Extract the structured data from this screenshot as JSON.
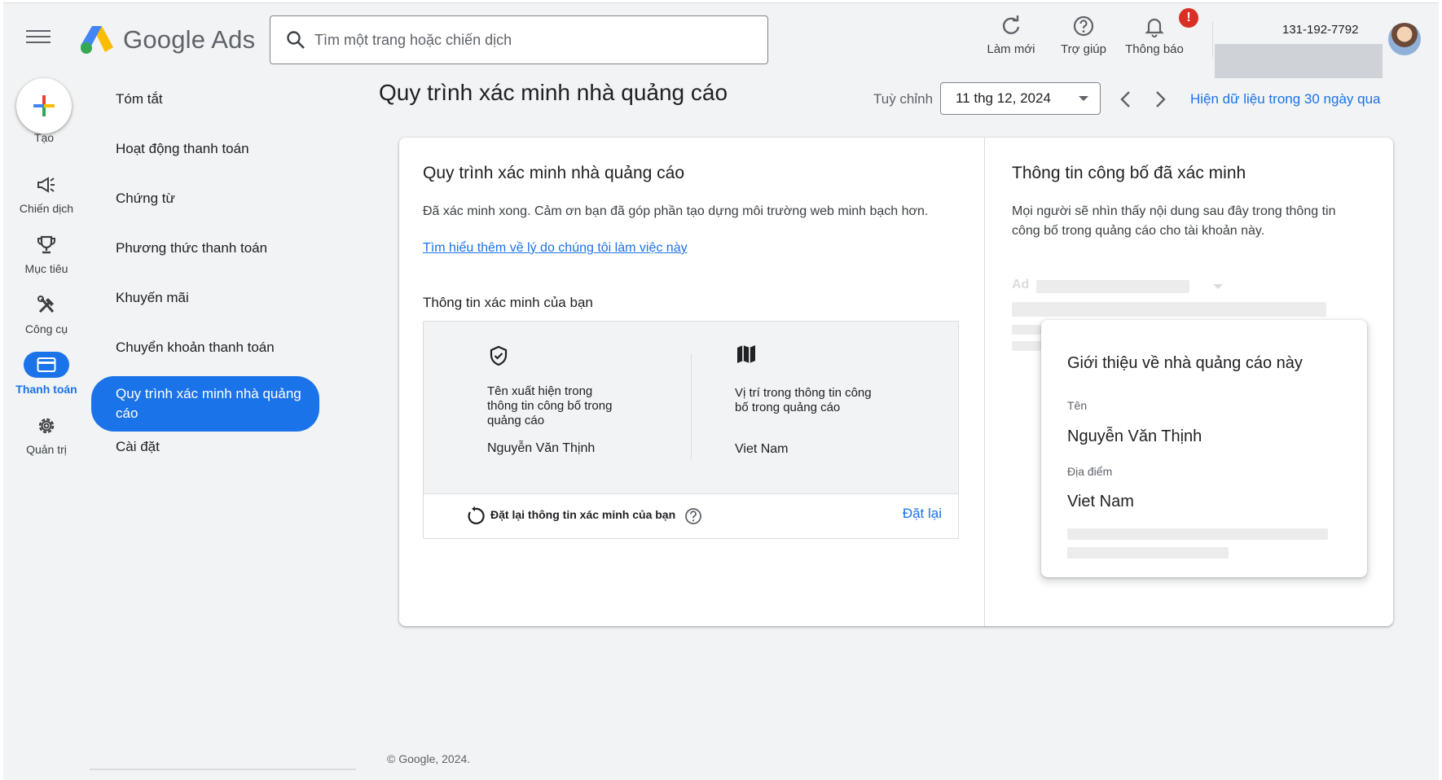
{
  "header": {
    "menu_icon": "hamburger-menu-icon",
    "app_name": "Google Ads",
    "search_placeholder": "Tìm một trang hoặc chiến dịch",
    "tools": [
      {
        "label": "Làm mới",
        "icon": "refresh-icon"
      },
      {
        "label": "Trợ giúp",
        "icon": "help-circle-icon"
      },
      {
        "label": "Thông báo",
        "icon": "bell-icon",
        "badge": "!"
      }
    ],
    "account_id": "131-192-7792"
  },
  "rail": {
    "create_label": "Tạo",
    "items": [
      {
        "label": "Chiến dịch",
        "icon": "megaphone-icon"
      },
      {
        "label": "Mục tiêu",
        "icon": "trophy-icon"
      },
      {
        "label": "Công cụ",
        "icon": "tools-icon"
      },
      {
        "label": "Thanh toán",
        "icon": "credit-card-icon",
        "active": true
      },
      {
        "label": "Quản trị",
        "icon": "gear-icon"
      }
    ]
  },
  "subnav": {
    "items": [
      "Tóm tắt",
      "Hoạt động thanh toán",
      "Chứng từ",
      "Phương thức thanh toán",
      "Khuyến mãi",
      "Chuyển khoản thanh toán",
      "Quy trình xác minh nhà quảng cáo",
      "Cài đặt"
    ],
    "active_index": 6
  },
  "page": {
    "title": "Quy trình xác minh nhà quảng cáo",
    "date_label": "Tuỳ chỉnh",
    "date_value": "11 thg 12, 2024",
    "range_link": "Hiện dữ liệu trong 30 ngày qua"
  },
  "left_panel": {
    "title": "Quy trình xác minh nhà quảng cáo",
    "description": "Đã xác minh xong. Cảm ơn bạn đã góp phần tạo dựng môi trường web minh bạch hơn.",
    "learn_more": "Tìm hiểu thêm về lý do chúng tôi làm việc này",
    "info_heading": "Thông tin xác minh của bạn",
    "name_label": "Tên xuất hiện trong thông tin công bố trong quảng cáo",
    "name_value": "Nguyễn Văn Thịnh",
    "location_label": "Vị trí trong thông tin công bố trong quảng cáo",
    "location_value": "Viet Nam",
    "reset_text": "Đặt lại thông tin xác minh của bạn",
    "reset_button": "Đặt lại"
  },
  "right_panel": {
    "title": "Thông tin công bố đã xác minh",
    "description": "Mọi người sẽ nhìn thấy nội dung sau đây trong thông tin công bố trong quảng cáo cho tài khoản này.",
    "ad_tag": "Ad",
    "about_title": "Giới thiệu về nhà quảng cáo này",
    "name_label": "Tên",
    "name_value": "Nguyễn Văn Thịnh",
    "location_label": "Địa điểm",
    "location_value": "Viet Nam"
  },
  "footer": "© Google, 2024.",
  "colors": {
    "accent": "#1a73e8",
    "background": "#f1f3f4",
    "badge": "#d93025"
  }
}
